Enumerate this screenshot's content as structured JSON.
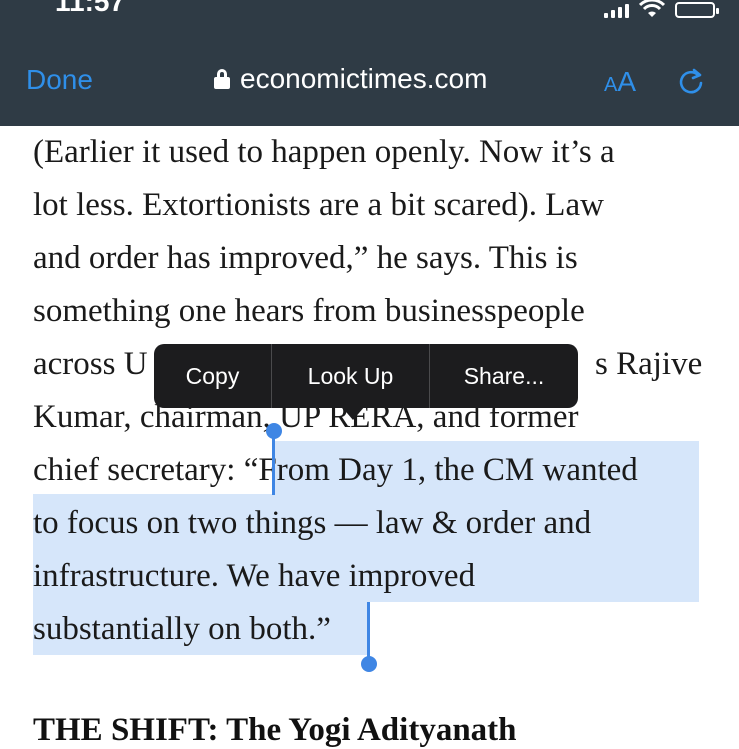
{
  "status_bar": {
    "time": "11:57"
  },
  "browser": {
    "done_label": "Done",
    "url": "economictimes.com",
    "text_size_label_small": "A",
    "text_size_label_big": "A",
    "icons": [
      "lock-icon",
      "reload-icon",
      "signal-icon",
      "wifi-icon",
      "battery-icon"
    ]
  },
  "article": {
    "lines": [
      "(Earlier it used to happen openly. Now it’s a",
      "lot less. Extortionists are a bit scared). Law",
      "and order has improved,” he says. This is",
      "something one hears from businesspeople",
      "across U",
      "s Rajive",
      "Kumar, chairman, UP RERA, and former",
      "chief secretary: “",
      "From Day 1, the CM wanted",
      "to focus on two things — law & order and",
      "infrastructure. We have improved",
      "substantially on both.”"
    ],
    "section_heading": "THE SHIFT: The Yogi Adityanath"
  },
  "context_menu": {
    "items": [
      "Copy",
      "Look Up",
      "Share..."
    ]
  },
  "colors": {
    "header_bg": "#2f3b45",
    "accent": "#2f8fe9",
    "selection": "#d6e6fa",
    "selection_handle": "#3f86e4",
    "menu_bg": "#1c1c1e"
  }
}
